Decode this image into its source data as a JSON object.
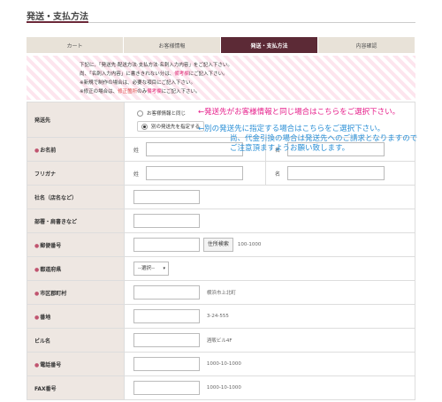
{
  "page": {
    "title": "発送・支払方法"
  },
  "steps": [
    {
      "label": "カート",
      "active": false
    },
    {
      "label": "お客様情報",
      "active": false
    },
    {
      "label": "発送・支払方法",
      "active": true
    },
    {
      "label": "内容確認",
      "active": false
    }
  ],
  "notice": {
    "line1a": "下記に、「発送先·配送方法·支払方法·名刺入力内容」をご記入下さい。",
    "line2a": "尚、「名刺入力内容」に書ききれない分は、",
    "line2b": "備考欄",
    "line2c": "にご記入下さい。",
    "line3a": "※新規で制作の場合は、必要な項目にご記入下さい。",
    "line4a": "※修正の場合は、",
    "line4b": "修正箇所",
    "line4c": "のみ",
    "line4d": "備考欄",
    "line4e": "にご記入下さい。"
  },
  "shipping": {
    "label": "発送先",
    "option_same": "お客様情報と同じ",
    "option_other": "別の発送先を指定する"
  },
  "annotations": {
    "pink": "←発送先がお客様情報と同じ場合はこちらをご選択下さい。",
    "blue1": "←別の発送先に指定する場合はこちらをご選択下さい。",
    "blue2": "尚、代金引換の場合は発送先へのご請求となりますので",
    "blue3": "ご注意頂ますようお願い致します。"
  },
  "fields": {
    "name": {
      "label": "お名前",
      "sei": "姓",
      "mei": "名"
    },
    "furigana": {
      "label": "フリガナ",
      "sei": "姓",
      "mei": "名"
    },
    "company": {
      "label": "社名（店名など）"
    },
    "dept": {
      "label": "部署・肩書きなど"
    },
    "zip": {
      "label": "郵便番号",
      "button": "住所検索",
      "hint": "100-1000"
    },
    "pref": {
      "label": "都道府県",
      "select": "--選択--"
    },
    "city": {
      "label": "市区郡町村",
      "hint": "横浜市上北町"
    },
    "street": {
      "label": "番地",
      "hint": "3-24-555"
    },
    "building": {
      "label": "ビル名",
      "hint": "酒販ビル4F"
    },
    "tel": {
      "label": "電話番号",
      "hint": "1000-10-1000"
    },
    "fax": {
      "label": "FAX番号",
      "hint": "1000-10-1000"
    }
  },
  "colors": {
    "accent": "#5c2a36",
    "label_bg": "#eee7e2",
    "annot_pink": "#e61d8a",
    "annot_blue": "#2a8fd6"
  }
}
